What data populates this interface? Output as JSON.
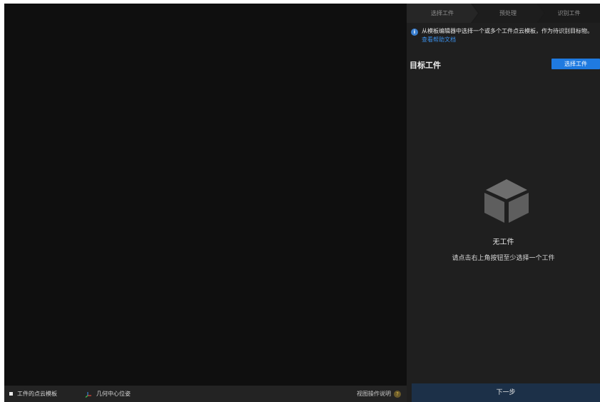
{
  "viewport": {
    "legend": [
      {
        "label": "工件的点云模板"
      },
      {
        "label": "几何中心位姿"
      }
    ],
    "help_label": "视图操作说明",
    "help_icon": "?"
  },
  "panel": {
    "steps": [
      {
        "label": "选择工件"
      },
      {
        "label": "预处理"
      },
      {
        "label": "识别工件"
      }
    ],
    "info": {
      "icon": "i",
      "text": "从模板编辑器中选择一个或多个工件点云模板，作为待识别目标物。",
      "link": "查看帮助文档"
    },
    "section_title": "目标工件",
    "select_button": "选择工件",
    "empty": {
      "title": "无工件",
      "subtitle": "请点击右上角按钮至少选择一个工件"
    },
    "next_button": "下一步"
  },
  "colors": {
    "accent": "#1f7ae0",
    "link": "#3b8fe8",
    "panel_bg": "#1f1f1f",
    "viewport_bg": "#0f0f0f"
  }
}
